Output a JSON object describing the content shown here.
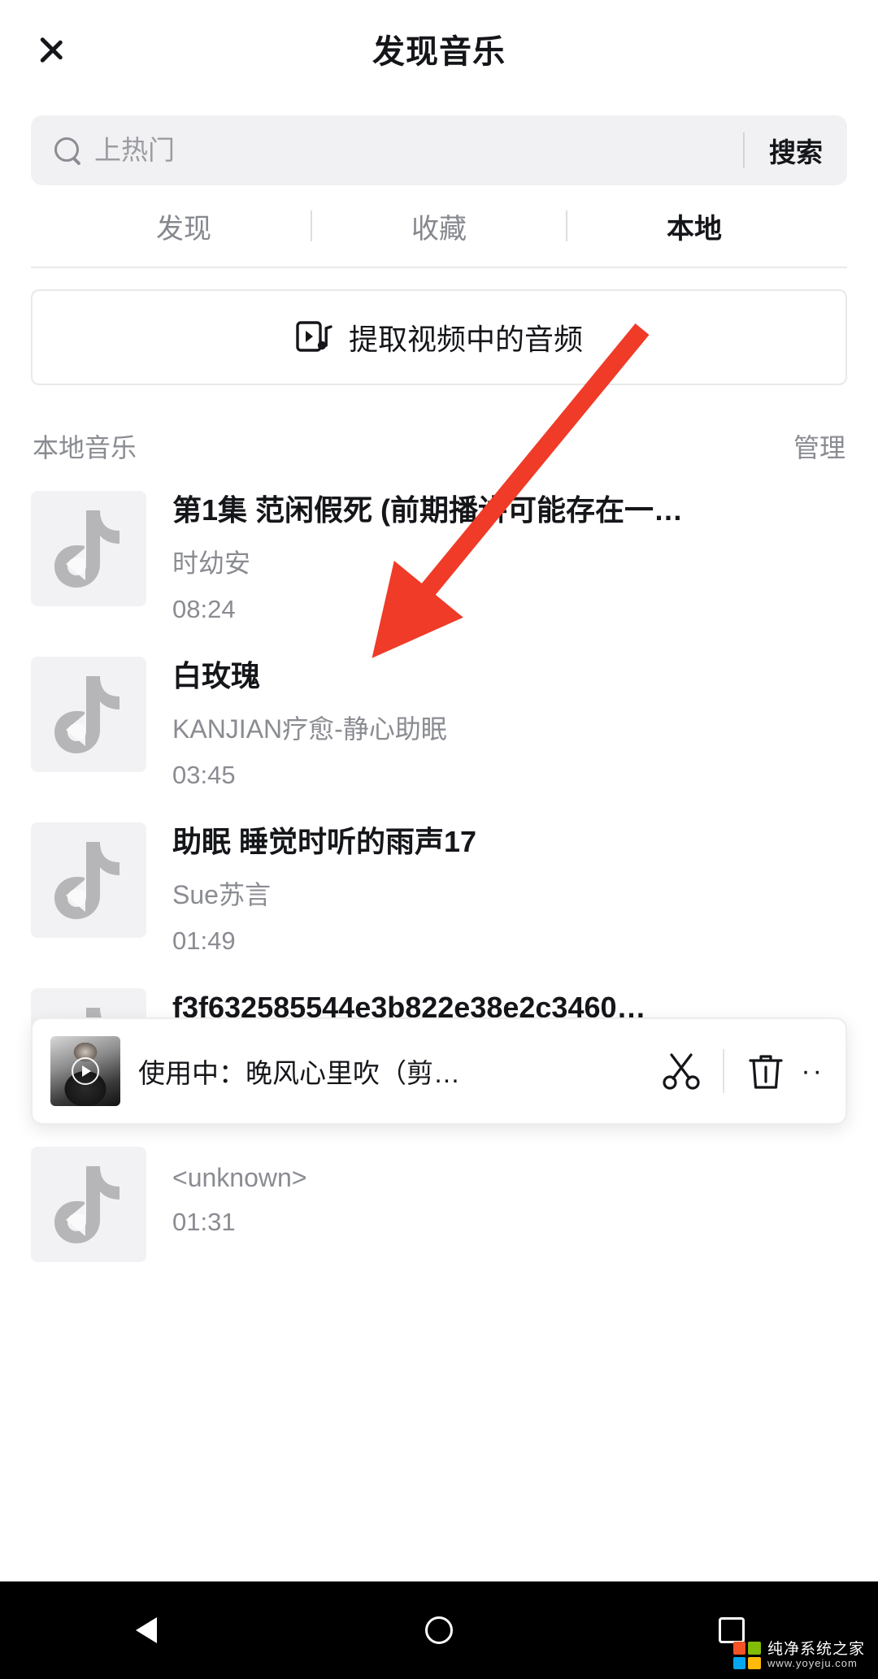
{
  "header": {
    "back_icon": "chevron-left-icon",
    "title": "发现音乐"
  },
  "search": {
    "icon": "search-icon",
    "value": "",
    "placeholder": "上热门",
    "button_label": "搜索"
  },
  "tabs": [
    {
      "label": "发现",
      "active": false
    },
    {
      "label": "收藏",
      "active": false
    },
    {
      "label": "本地",
      "active": true
    }
  ],
  "extract": {
    "icon": "video-music-icon",
    "label": "提取视频中的音频"
  },
  "section": {
    "title": "本地音乐",
    "action_label": "管理"
  },
  "tracks": [
    {
      "title": "第1集 范闲假死 (前期播讲可能存在一…",
      "artist": "时幼安",
      "duration": "08:24",
      "thumb_icon": "music-note-icon"
    },
    {
      "title": "白玫瑰",
      "artist": "KANJIAN疗愈-静心助眠",
      "duration": "03:45",
      "thumb_icon": "music-note-icon"
    },
    {
      "title": "助眠 睡觉时听的雨声17",
      "artist": "Sue苏言",
      "duration": "01:49",
      "thumb_icon": "music-note-icon"
    },
    {
      "title": "f3f632585544e3b822e38e2c3460…",
      "artist": "<unknown>",
      "duration": "01:31",
      "thumb_icon": "music-note-icon"
    },
    {
      "title": "",
      "artist": "<unknown>",
      "duration": "01:31",
      "thumb_icon": "music-note-icon"
    }
  ],
  "player": {
    "thumb_icon": "play-circle-icon",
    "text": "使用中：晚风心里吹（剪…",
    "cut_icon": "scissors-icon",
    "delete_icon": "trash-icon",
    "more_icon": "ellipsis-icon",
    "more_label": "··"
  },
  "navbar": {
    "back_icon": "nav-back-triangle-icon",
    "home_icon": "nav-home-circle-icon",
    "recent_icon": "nav-recent-square-icon"
  },
  "watermark": {
    "logo_icon": "windows-logo-icon",
    "main": "纯净系统之家",
    "sub": "www.yoyeju.com"
  },
  "annotation": {
    "arrow_icon": "red-arrow-icon",
    "color": "#ef3b27"
  }
}
